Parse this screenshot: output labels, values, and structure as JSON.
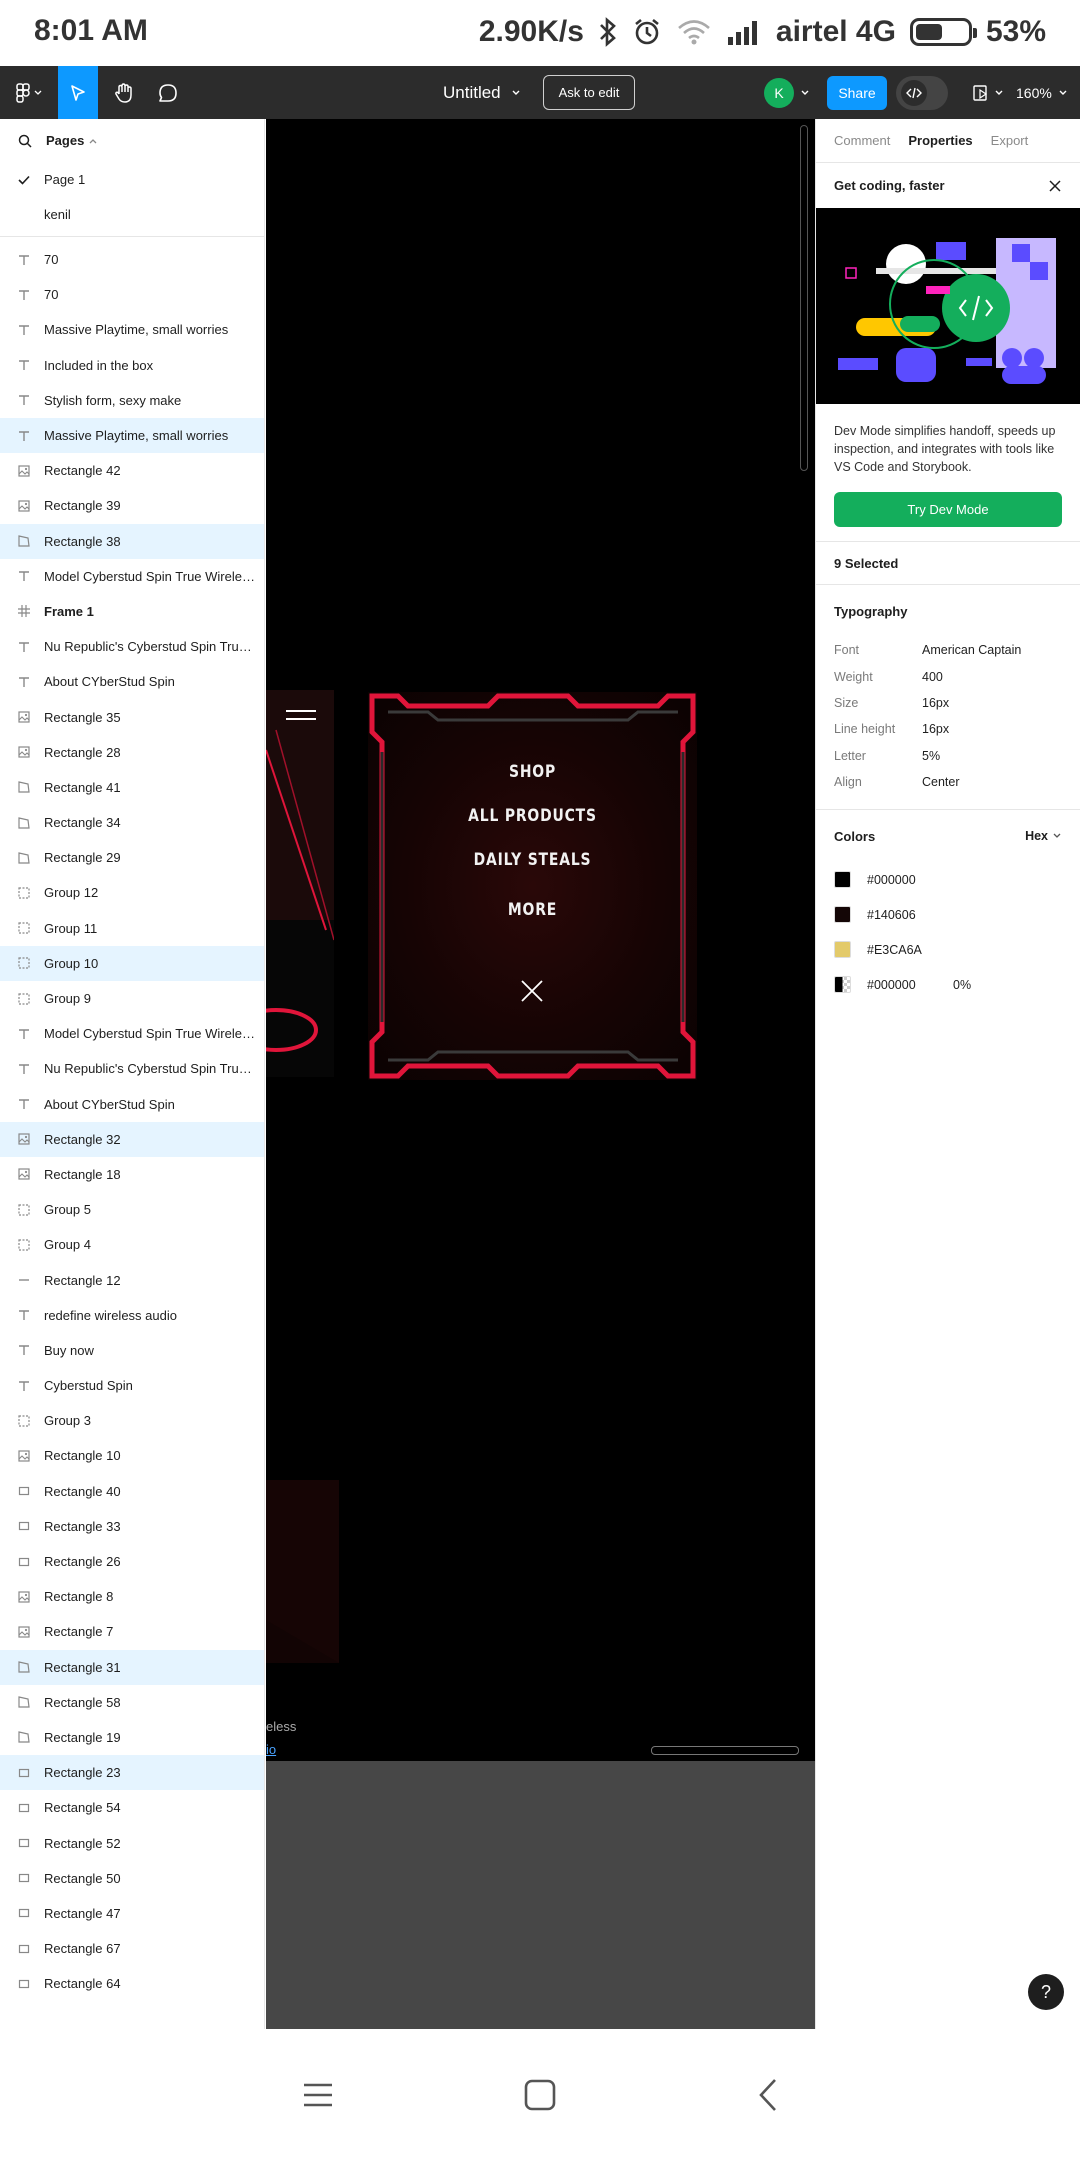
{
  "status_bar": {
    "time": "8:01 AM",
    "speed": "2.90K/s",
    "carrier": "airtel 4G",
    "battery": "53%",
    "battery_level": 0.53
  },
  "toolbar": {
    "file_title": "Untitled",
    "ask_to_edit": "Ask to edit",
    "avatar_initial": "K",
    "share": "Share",
    "zoom": "160%",
    "accent": "#0d99ff"
  },
  "pages": {
    "header": "Pages",
    "items": [
      "Page 1",
      "kenil"
    ],
    "current": "Page 1"
  },
  "layers": [
    {
      "name": "70",
      "icon": "text-icon",
      "selected": false
    },
    {
      "name": "70",
      "icon": "text-icon",
      "selected": false
    },
    {
      "name": "Massive Playtime, small worries",
      "icon": "text-icon",
      "selected": false
    },
    {
      "name": "Included in the box",
      "icon": "text-icon",
      "selected": false
    },
    {
      "name": "Stylish form, sexy make",
      "icon": "text-icon",
      "selected": false
    },
    {
      "name": "Massive Playtime, small worries",
      "icon": "text-icon",
      "selected": true
    },
    {
      "name": "Rectangle 42",
      "icon": "image-icon",
      "selected": false
    },
    {
      "name": "Rectangle 39",
      "icon": "image-icon",
      "selected": false
    },
    {
      "name": "Rectangle 38",
      "icon": "vector-icon",
      "selected": true
    },
    {
      "name": "Model Cyberstud Spin True Wireless Earbuds",
      "icon": "text-icon",
      "selected": false
    },
    {
      "name": "Frame 1",
      "icon": "frame-icon",
      "selected": false
    },
    {
      "name": "Nu Republic's Cyberstud Spin True Wireless Earbuds",
      "icon": "text-icon",
      "selected": false
    },
    {
      "name": "About CYberStud Spin",
      "icon": "text-icon",
      "selected": false
    },
    {
      "name": "Rectangle 35",
      "icon": "image-icon",
      "selected": false
    },
    {
      "name": "Rectangle 28",
      "icon": "image-icon",
      "selected": false
    },
    {
      "name": "Rectangle 41",
      "icon": "vector-icon",
      "selected": false
    },
    {
      "name": "Rectangle 34",
      "icon": "vector-icon",
      "selected": false
    },
    {
      "name": "Rectangle 29",
      "icon": "vector-icon",
      "selected": false
    },
    {
      "name": "Group 12",
      "icon": "group-icon",
      "selected": false
    },
    {
      "name": "Group 11",
      "icon": "group-icon",
      "selected": false
    },
    {
      "name": "Group 10",
      "icon": "group-icon",
      "selected": true
    },
    {
      "name": "Group 9",
      "icon": "group-icon",
      "selected": false
    },
    {
      "name": "Model Cyberstud Spin True Wireless Earbuds",
      "icon": "text-icon",
      "selected": false
    },
    {
      "name": "Nu Republic's Cyberstud Spin True Wireless Earbuds",
      "icon": "text-icon",
      "selected": false
    },
    {
      "name": "About CYberStud Spin",
      "icon": "text-icon",
      "selected": false
    },
    {
      "name": "Rectangle 32",
      "icon": "image-icon",
      "selected": true
    },
    {
      "name": "Rectangle 18",
      "icon": "image-icon",
      "selected": false
    },
    {
      "name": "Group 5",
      "icon": "group-icon",
      "selected": false
    },
    {
      "name": "Group 4",
      "icon": "group-icon",
      "selected": false
    },
    {
      "name": "Rectangle 12",
      "icon": "line-icon",
      "selected": false
    },
    {
      "name": "redefine wireless audio",
      "icon": "text-icon",
      "selected": false
    },
    {
      "name": "Buy now",
      "icon": "text-icon",
      "selected": false
    },
    {
      "name": "Cyberstud Spin",
      "icon": "text-icon",
      "selected": false
    },
    {
      "name": "Group 3",
      "icon": "group-icon",
      "selected": false
    },
    {
      "name": "Rectangle 10",
      "icon": "image-icon",
      "selected": false
    },
    {
      "name": "Rectangle 40",
      "icon": "rect-icon",
      "selected": false
    },
    {
      "name": "Rectangle 33",
      "icon": "rect-icon",
      "selected": false
    },
    {
      "name": "Rectangle 26",
      "icon": "rect-icon",
      "selected": false
    },
    {
      "name": "Rectangle 8",
      "icon": "image-icon",
      "selected": false
    },
    {
      "name": "Rectangle 7",
      "icon": "image-icon",
      "selected": false
    },
    {
      "name": "Rectangle 31",
      "icon": "vector-icon",
      "selected": true
    },
    {
      "name": "Rectangle 58",
      "icon": "vector-icon",
      "selected": false
    },
    {
      "name": "Rectangle 19",
      "icon": "vector-icon",
      "selected": false
    },
    {
      "name": "Rectangle 23",
      "icon": "rect-icon",
      "selected": true
    },
    {
      "name": "Rectangle 54",
      "icon": "rect-icon",
      "selected": false
    },
    {
      "name": "Rectangle 52",
      "icon": "rect-icon",
      "selected": false
    },
    {
      "name": "Rectangle 50",
      "icon": "rect-icon",
      "selected": false
    },
    {
      "name": "Rectangle 47",
      "icon": "rect-icon",
      "selected": false
    },
    {
      "name": "Rectangle 67",
      "icon": "rect-icon",
      "selected": false
    },
    {
      "name": "Rectangle 64",
      "icon": "rect-icon",
      "selected": false
    }
  ],
  "canvas": {
    "menu_items": [
      "SHOP",
      "ALL PRODUCTS",
      "DAILY STEALS",
      "MORE"
    ],
    "wireless_fragment": "eless",
    "audio_fragment": "io",
    "frame_accent": "#e0153a"
  },
  "properties": {
    "tabs": [
      "Comment",
      "Properties",
      "Export"
    ],
    "active_tab": "Properties",
    "promo": {
      "title": "Get coding, faster",
      "text": "Dev Mode simplifies handoff, speeds up inspection, and integrates with tools like VS Code and Storybook.",
      "button": "Try Dev Mode"
    },
    "selected": "9 Selected",
    "typography": {
      "title": "Typography",
      "rows": [
        {
          "label": "Font",
          "value": "American Captain"
        },
        {
          "label": "Weight",
          "value": "400"
        },
        {
          "label": "Size",
          "value": "16px"
        },
        {
          "label": "Line height",
          "value": "16px"
        },
        {
          "label": "Letter",
          "value": "5%"
        },
        {
          "label": "Align",
          "value": "Center"
        }
      ]
    },
    "colors": {
      "title": "Colors",
      "format": "Hex",
      "items": [
        {
          "hex": "#000000",
          "opacity": "",
          "swatch": "#000000"
        },
        {
          "hex": "#140606",
          "opacity": "",
          "swatch": "#140606"
        },
        {
          "hex": "#E3CA6A",
          "opacity": "",
          "swatch": "#E3CA6A"
        },
        {
          "hex": "#000000",
          "opacity": "0%",
          "swatch": "transparent"
        }
      ]
    },
    "help": "?"
  }
}
